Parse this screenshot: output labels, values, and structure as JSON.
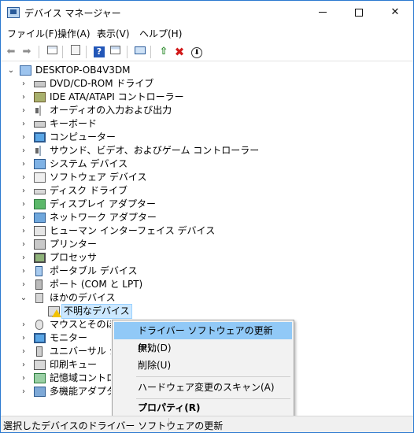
{
  "window": {
    "title": "デバイス マネージャー"
  },
  "menubar": {
    "file": "ファイル(F)",
    "action": "操作(A)",
    "view": "表示(V)",
    "help": "ヘルプ(H)"
  },
  "tree": {
    "root": "DESKTOP-OB4V3DM",
    "categories": [
      "DVD/CD-ROM ドライブ",
      "IDE ATA/ATAPI コントローラー",
      "オーディオの入力および出力",
      "キーボード",
      "コンピューター",
      "サウンド、ビデオ、およびゲーム コントローラー",
      "システム デバイス",
      "ソフトウェア デバイス",
      "ディスク ドライブ",
      "ディスプレイ アダプター",
      "ネットワーク アダプター",
      "ヒューマン インターフェイス デバイス",
      "プリンター",
      "プロセッサ",
      "ポータブル デバイス",
      "ポート (COM と LPT)",
      "ほかのデバイス",
      "不明なデバイス",
      "マウスとそのほかのポインティング デバイス",
      "モニター",
      "ユニバーサル シリアル バス コントローラー",
      "印刷キュー",
      "記憶域コントローラー",
      "多機能アダプター"
    ],
    "visible_labels": [
      "DVD/CD-ROM ドライブ",
      "IDE ATA/ATAPI コントローラー",
      "オーディオの入力および出力",
      "キーボード",
      "コンピューター",
      "サウンド、ビデオ、およびゲーム コントローラー",
      "システム デバイス",
      "ソフトウェア デバイス",
      "ディスク ドライブ",
      "ディスプレイ アダプター",
      "ネットワーク アダプター",
      "ヒューマン インターフェイス デバイス",
      "プリンター",
      "プロセッサ",
      "ポータブル デバイス",
      "ポート (COM と LPT)",
      "ほかのデバイス",
      "不明なデバイス",
      "マウスとそのほかの",
      "モニター",
      "ユニバーサル シリ",
      "印刷キュー",
      "記憶域コントロー",
      "多機能アダプター"
    ]
  },
  "context_menu": {
    "update_driver": "ドライバー ソフトウェアの更新(P)...",
    "disable": "無効(D)",
    "uninstall": "削除(U)",
    "scan": "ハードウェア変更のスキャン(A)",
    "properties": "プロパティ(R)"
  },
  "statusbar": {
    "text": "選択したデバイスのドライバー ソフトウェアの更新"
  },
  "colors": {
    "highlight": "#91c9f7",
    "selection": "#cce8ff",
    "warning": "#f2c200",
    "uninstall_red": "#d11a1a"
  },
  "icons": {
    "back": "arrow-left-icon",
    "forward": "arrow-right-icon",
    "properties": "properties-icon",
    "help": "help-icon",
    "scan": "scan-icon",
    "update": "update-driver-icon",
    "uninstall": "uninstall-x-icon",
    "disable": "disable-icon"
  }
}
